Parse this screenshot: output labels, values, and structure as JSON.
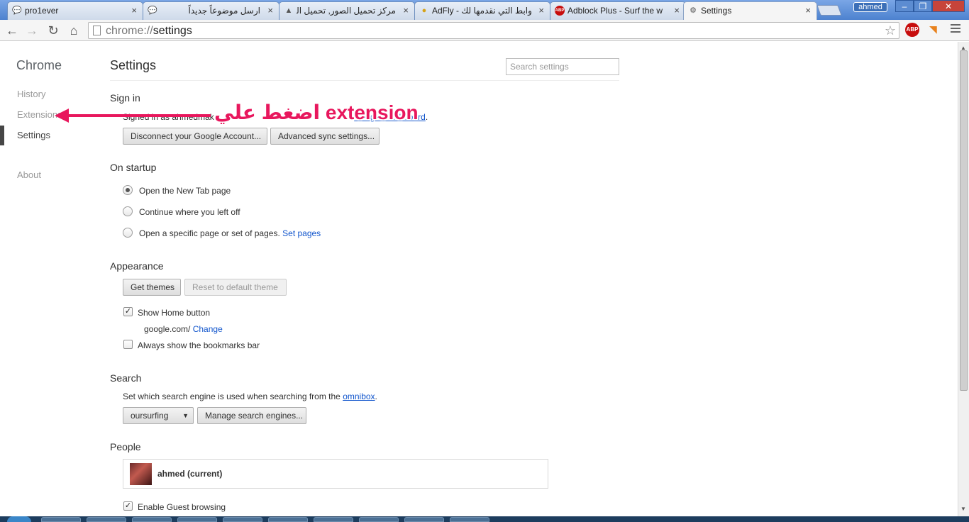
{
  "tabs": [
    {
      "title": "pro1ever",
      "icon": "chat-icon"
    },
    {
      "title": "ارسل موضوعاً جديداً",
      "icon": "chat-icon"
    },
    {
      "title": "مركز تحميل الصور, تحميل الصور",
      "icon": "picture-icon"
    },
    {
      "title": "AdFly - الروابط التي نقدمها لك",
      "icon": "bee-icon"
    },
    {
      "title": "Adblock Plus - Surf the w",
      "icon": "abp-icon"
    },
    {
      "title": "Settings",
      "icon": "gear-icon"
    }
  ],
  "tab_close_glyph": "×",
  "window": {
    "profile_badge": "ahmed",
    "min": "–",
    "max": "❐",
    "close": "✕"
  },
  "toolbar": {
    "back": "←",
    "forward": "→",
    "reload": "↻",
    "home": "⌂",
    "url_scheme": "chrome://",
    "url_path": "settings",
    "star": "☆",
    "abp_label": "ABP",
    "rss": "◥"
  },
  "sidebar": {
    "title": "Chrome",
    "items": [
      {
        "label": "History"
      },
      {
        "label": "Extensions"
      },
      {
        "label": "Settings"
      },
      {
        "label": "About"
      }
    ]
  },
  "main": {
    "title": "Settings",
    "search_placeholder": "Search settings"
  },
  "signin": {
    "title": "Sign in",
    "signed_in_prefix": "Signed in as ahmedmak",
    "signed_in_suffix": "r",
    "dashboard_link": "Google Dashboard",
    "period": ".",
    "disconnect_button": "Disconnect your Google Account...",
    "advanced_sync_button": "Advanced sync settings..."
  },
  "startup": {
    "title": "On startup",
    "options": [
      {
        "label": "Open the New Tab page",
        "selected": true
      },
      {
        "label": "Continue where you left off",
        "selected": false
      },
      {
        "label": "Open a specific page or set of pages.",
        "selected": false
      }
    ],
    "set_pages_link": "Set pages"
  },
  "appearance": {
    "title": "Appearance",
    "get_themes": "Get themes",
    "reset_theme": "Reset to default theme",
    "show_home_label": "Show Home button",
    "show_home_checked": true,
    "home_url": "google.com/",
    "change_link": "Change",
    "bookmarks_bar_label": "Always show the bookmarks bar",
    "bookmarks_bar_checked": false
  },
  "search": {
    "title": "Search",
    "description": "Set which search engine is used when searching from the",
    "omnibox_link": "omnibox",
    "period": ".",
    "selected_engine": "oursurfing",
    "manage_button": "Manage search engines..."
  },
  "people": {
    "title": "People",
    "profile_name": "ahmed (current)",
    "guest_label": "Enable Guest browsing",
    "guest_checked": true
  },
  "annotation": {
    "text": "اضغط علي extension",
    "color": "#e8175d"
  },
  "check_glyph": "✓",
  "scroll": {
    "up": "▲",
    "down": "▼"
  }
}
